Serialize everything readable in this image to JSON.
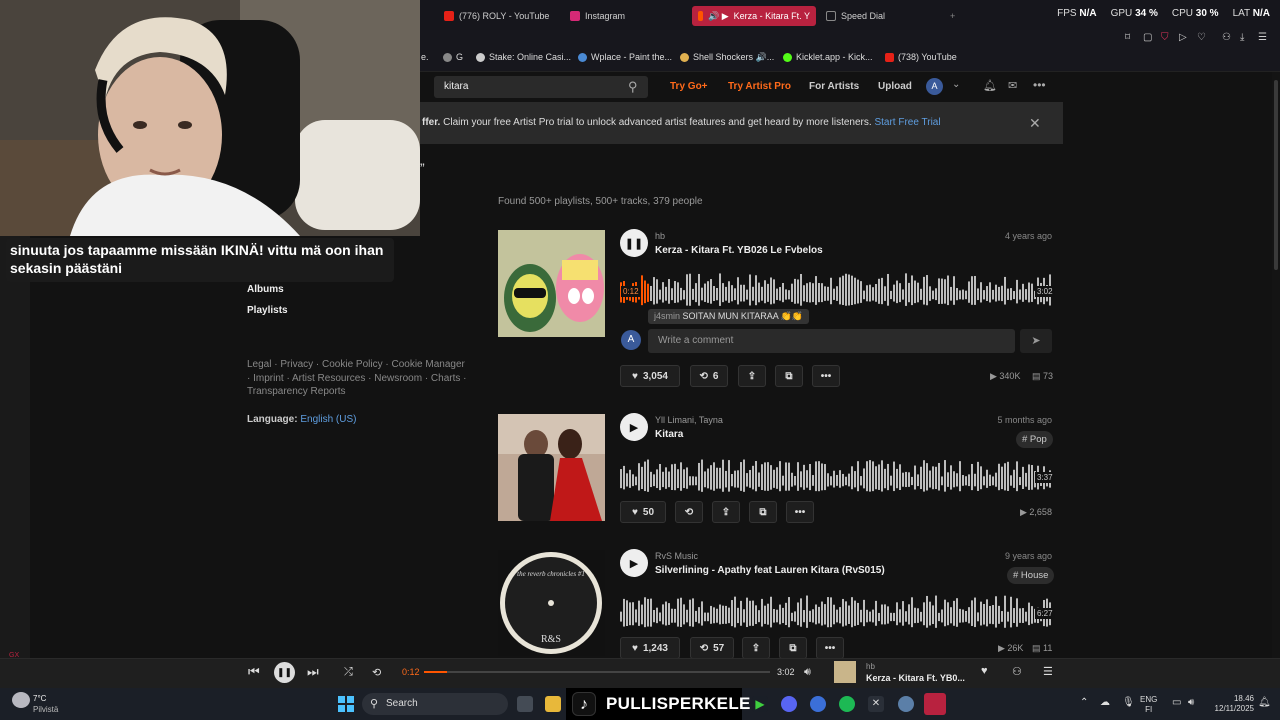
{
  "browser": {
    "tabs": [
      {
        "label": "(776) ROLY - YouTube",
        "color": "#e62117"
      },
      {
        "label": "Instagram",
        "color": "#d62976"
      },
      {
        "label": "Kerza - Kitara Ft. Y",
        "color": "#ff5500"
      },
      {
        "label": "Speed Dial",
        "color": "#666666"
      }
    ],
    "new_tab": "+",
    "stats": {
      "fps_label": "FPS",
      "fps_value": "N/A",
      "gpu_label": "GPU",
      "gpu_value": "34 %",
      "cpu_label": "CPU",
      "cpu_value": "30 %",
      "lat_label": "LAT",
      "lat_value": "N/A"
    },
    "bookmarks": [
      {
        "label": "e.",
        "color": "#555555"
      },
      {
        "label": "G",
        "color": "#888888"
      },
      {
        "label": "Stake: Online Casi...",
        "color": "#cccccc"
      },
      {
        "label": "Wplace - Paint the...",
        "color": "#4a8ad4"
      },
      {
        "label": "Shell Shockers 🔊...",
        "color": "#e0b050"
      },
      {
        "label": "Kicklet.app - Kick...",
        "color": "#53fc18"
      },
      {
        "label": "(738) YouTube",
        "color": "#e62117"
      }
    ]
  },
  "soundcloud": {
    "search_value": "kitara",
    "nav": {
      "try_go": "Try Go+",
      "try_artist_pro": "Try Artist Pro",
      "for_artists": "For Artists",
      "upload": "Upload",
      "avatar_letter": "A"
    },
    "banner": {
      "text_bold": "ffer.",
      "text": "Claim your free Artist Pro trial to unlock advanced artist features and get heard by more listeners.",
      "link": "Start Free Trial"
    },
    "stray_quote": "”",
    "left_menu": [
      "ople",
      "Albums",
      "Playlists"
    ],
    "footer_links": "Legal · Privacy · Cookie Policy · Cookie Manager · Imprint · Artist Resources · Newsroom · Charts · Transparency Reports",
    "language_label": "Language:",
    "language_value": "English (US)",
    "found_text": "Found 500+ playlists, 500+ tracks, 379 people",
    "tracks": [
      {
        "artist": "hb",
        "title": "Kerza - Kitara Ft. YB026 Le Fvbelos",
        "age": "4 years ago",
        "tag": "",
        "elapsed": "0:12",
        "duration": "3:02",
        "likes": "3,054",
        "reposts": "6",
        "plays": "340K",
        "comments": "73",
        "playing": true,
        "progress": 0.066
      },
      {
        "artist": "Yll Limani, Tayna",
        "title": "Kitara",
        "age": "5 months ago",
        "tag": "# Pop",
        "duration": "3:37",
        "likes": "50",
        "reposts": "",
        "plays": "2,658",
        "comments": "",
        "playing": false
      },
      {
        "artist": "RvS Music",
        "title": "Silverlining - Apathy feat Lauren Kitara (RvS015)",
        "age": "9 years ago",
        "tag": "# House",
        "duration": "6:27",
        "likes": "1,243",
        "reposts": "57",
        "plays": "26K",
        "comments": "11",
        "playing": false
      }
    ],
    "comment": {
      "chip_user": "j4smin",
      "chip_text": "SOITAN MUN KITARAA 👏👏",
      "avatar_letter": "A",
      "placeholder": "Write a comment"
    },
    "album_art_3_text": "the reverb chronicles #1",
    "player": {
      "elapsed": "0:12",
      "duration": "3:02",
      "artist": "hb",
      "title": "Kerza - Kitara Ft. YB0...",
      "progress": 0.066
    }
  },
  "stream": {
    "caption": "sinuuta jos tapaamme missään IKINÄ! vittu mä oon ihan sekasin päästäni",
    "tiktok_name": "PULLISPERKELE"
  },
  "taskbar": {
    "weather_temp": "7°C",
    "weather_desc": "Pilvistä",
    "search_label": "Search",
    "lang_top": "ENG",
    "lang_bottom": "FI",
    "time": "18.46",
    "date": "12/11/2025"
  },
  "colors": {
    "accent": "#ff5500",
    "link": "#5f9ee0",
    "tab_active": "#b8223f"
  }
}
